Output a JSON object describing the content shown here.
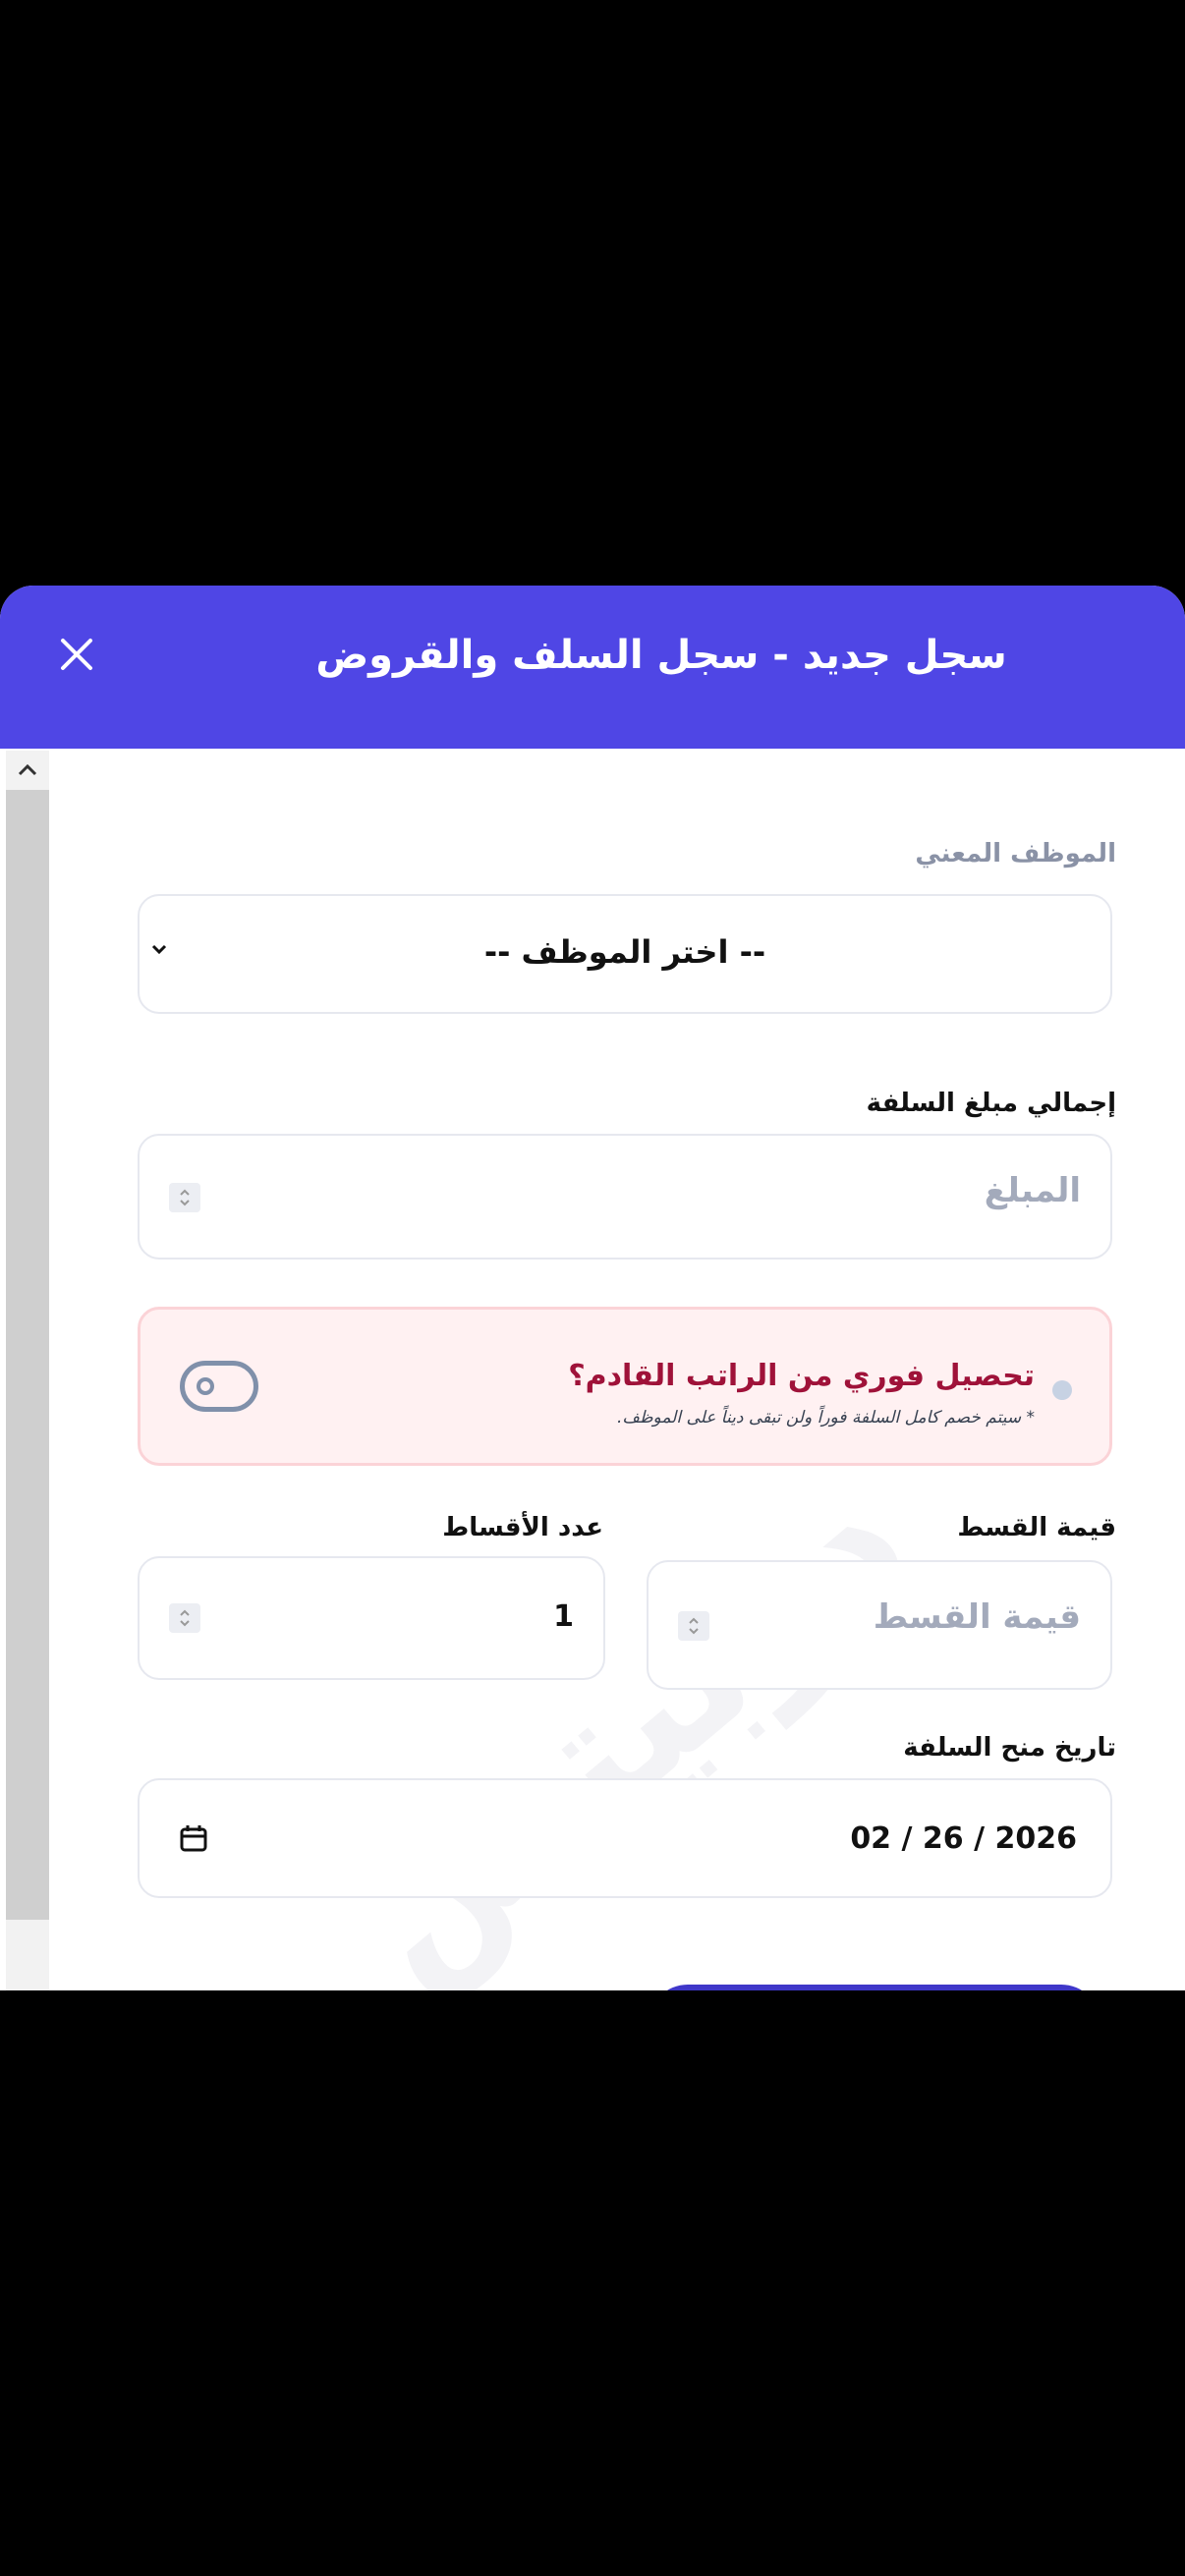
{
  "header": {
    "title": "سجل جديد - سجل السلف والقروض"
  },
  "form": {
    "employee": {
      "label": "الموظف المعني",
      "selected": "-- اختر الموظف --"
    },
    "total_amount": {
      "label": "إجمالي مبلغ السلفة",
      "placeholder": "المبلغ"
    },
    "instant_collection": {
      "title": "تحصيل فوري من الراتب القادم؟",
      "note": "* سيتم خصم كامل السلفة فوراً ولن تبقى ديناً على الموظف.",
      "enabled": false
    },
    "installment_value": {
      "label": "قيمة القسط",
      "placeholder": "قيمة القسط"
    },
    "installments_count": {
      "label": "عدد الأقساط",
      "value": "1"
    },
    "grant_date": {
      "label": "تاريخ منح السلفة",
      "value": "02 / 26 / 2026"
    }
  },
  "watermark": "دوبيتش",
  "colors": {
    "header": "#4f46e5",
    "alert_bg": "#fff1f2",
    "alert_title": "#9f1239"
  },
  "icons": [
    "close-icon",
    "chevron-up-icon",
    "chevron-down-icon",
    "spinner-icon",
    "toggle-icon",
    "calendar-icon"
  ]
}
